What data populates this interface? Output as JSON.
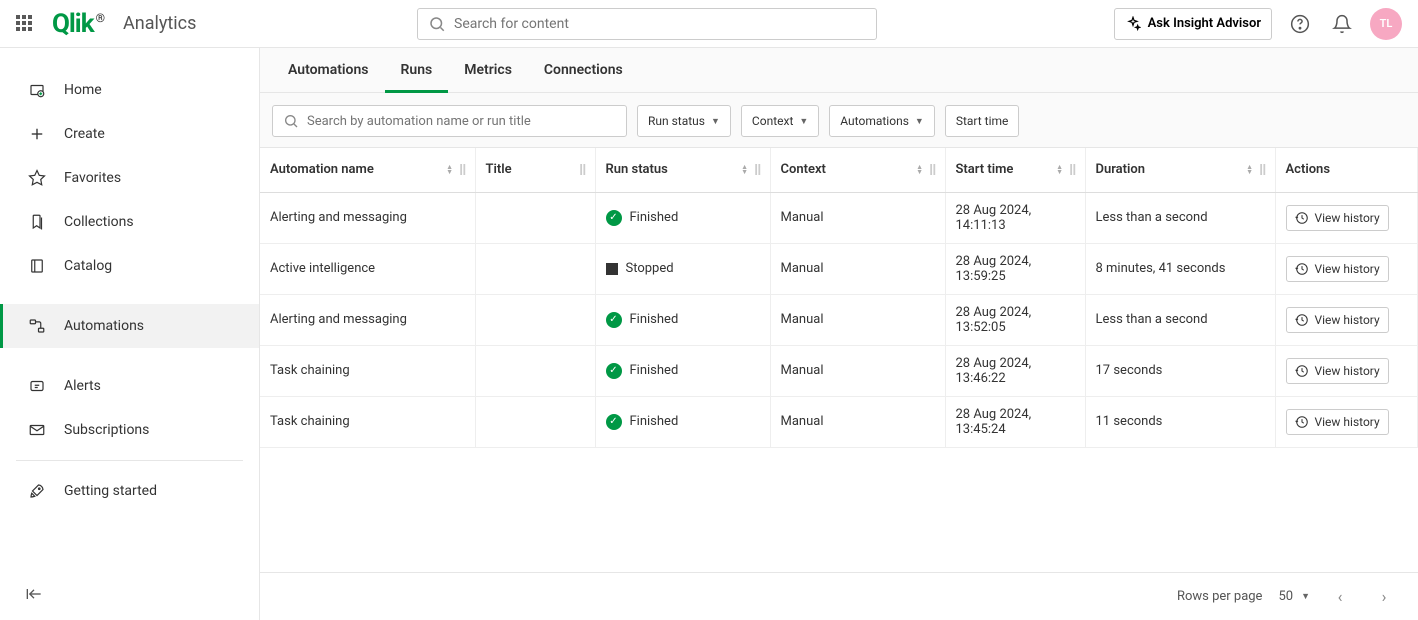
{
  "brand": "Qlik",
  "app_title": "Analytics",
  "search": {
    "placeholder": "Search for content"
  },
  "topbar": {
    "ask_label": "Ask Insight Advisor",
    "avatar_initials": "TL"
  },
  "sidebar": {
    "items": [
      {
        "label": "Home"
      },
      {
        "label": "Create"
      },
      {
        "label": "Favorites"
      },
      {
        "label": "Collections"
      },
      {
        "label": "Catalog"
      },
      {
        "label": "Automations"
      },
      {
        "label": "Alerts"
      },
      {
        "label": "Subscriptions"
      },
      {
        "label": "Getting started"
      }
    ]
  },
  "tabs": [
    {
      "label": "Automations"
    },
    {
      "label": "Runs"
    },
    {
      "label": "Metrics"
    },
    {
      "label": "Connections"
    }
  ],
  "filters": {
    "search_placeholder": "Search by automation name or run title",
    "run_status": "Run status",
    "context": "Context",
    "automations": "Automations",
    "start_time": "Start time"
  },
  "table": {
    "headers": {
      "automation_name": "Automation name",
      "title": "Title",
      "run_status": "Run status",
      "context": "Context",
      "start_time": "Start time",
      "duration": "Duration",
      "actions": "Actions"
    },
    "rows": [
      {
        "name": "Alerting and messaging",
        "title": "",
        "status": "Finished",
        "status_kind": "finished",
        "context": "Manual",
        "start": "28 Aug 2024, 14:11:13",
        "duration": "Less than a second"
      },
      {
        "name": "Active intelligence",
        "title": "",
        "status": "Stopped",
        "status_kind": "stopped",
        "context": "Manual",
        "start": "28 Aug 2024, 13:59:25",
        "duration": "8 minutes, 41 seconds"
      },
      {
        "name": "Alerting and messaging",
        "title": "",
        "status": "Finished",
        "status_kind": "finished",
        "context": "Manual",
        "start": "28 Aug 2024, 13:52:05",
        "duration": "Less than a second"
      },
      {
        "name": "Task chaining",
        "title": "",
        "status": "Finished",
        "status_kind": "finished",
        "context": "Manual",
        "start": "28 Aug 2024, 13:46:22",
        "duration": "17 seconds"
      },
      {
        "name": "Task chaining",
        "title": "",
        "status": "Finished",
        "status_kind": "finished",
        "context": "Manual",
        "start": "28 Aug 2024, 13:45:24",
        "duration": "11 seconds"
      }
    ],
    "action_label": "View history"
  },
  "pagination": {
    "rows_label": "Rows per page",
    "rows_value": "50"
  }
}
